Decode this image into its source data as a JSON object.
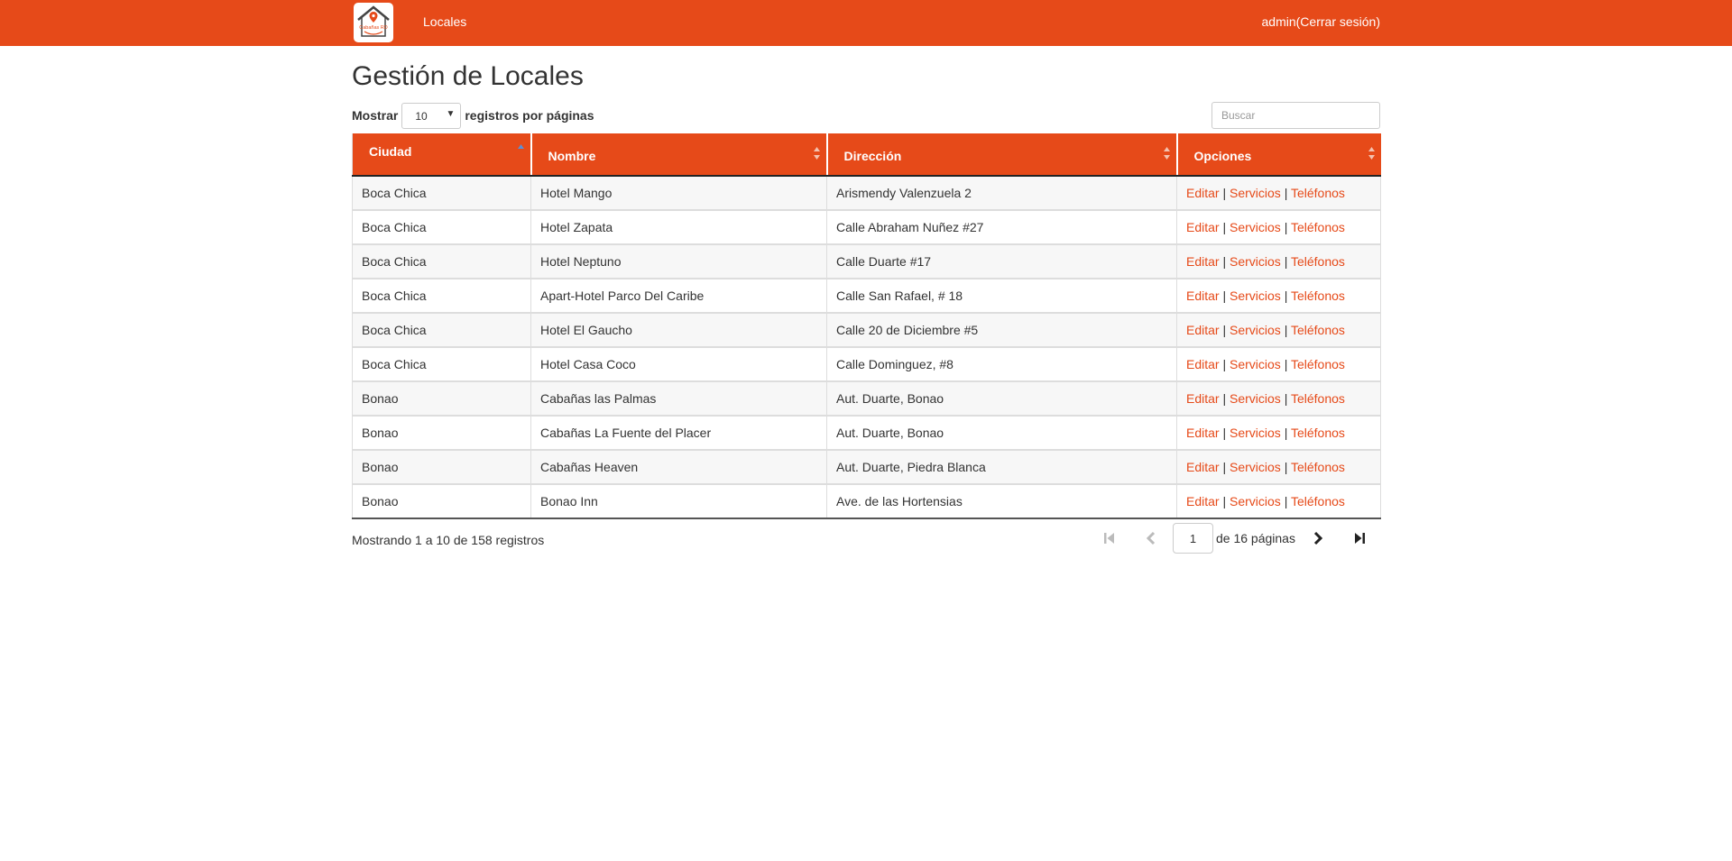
{
  "header": {
    "logo_text": "Cabañas RD",
    "nav_label": "Locales",
    "user_label": "admin(Cerrar sesión)"
  },
  "page": {
    "title": "Gestión de Locales"
  },
  "length_control": {
    "prefix": "Mostrar",
    "selected": "10",
    "suffix": "registros por páginas"
  },
  "search": {
    "placeholder": "Buscar",
    "value": ""
  },
  "table": {
    "columns": [
      "Ciudad",
      "Nombre",
      "Dirección",
      "Opciones"
    ],
    "sorted_column": "Ciudad",
    "rows": [
      {
        "ciudad": "Boca Chica",
        "nombre": "Hotel Mango",
        "direccion": "Arismendy Valenzuela 2"
      },
      {
        "ciudad": "Boca Chica",
        "nombre": "Hotel Zapata",
        "direccion": "Calle Abraham Nuñez #27"
      },
      {
        "ciudad": "Boca Chica",
        "nombre": "Hotel Neptuno",
        "direccion": "Calle Duarte #17"
      },
      {
        "ciudad": "Boca Chica",
        "nombre": "Apart-Hotel Parco Del Caribe",
        "direccion": "Calle San Rafael, # 18"
      },
      {
        "ciudad": "Boca Chica",
        "nombre": "Hotel El Gaucho",
        "direccion": "Calle 20 de Diciembre #5"
      },
      {
        "ciudad": "Boca Chica",
        "nombre": "Hotel Casa Coco",
        "direccion": "Calle Dominguez, #8"
      },
      {
        "ciudad": "Bonao",
        "nombre": "Cabañas las Palmas",
        "direccion": "Aut. Duarte, Bonao"
      },
      {
        "ciudad": "Bonao",
        "nombre": "Cabañas La Fuente del Placer",
        "direccion": "Aut. Duarte, Bonao"
      },
      {
        "ciudad": "Bonao",
        "nombre": "Cabañas Heaven",
        "direccion": "Aut. Duarte, Piedra Blanca"
      },
      {
        "ciudad": "Bonao",
        "nombre": "Bonao Inn",
        "direccion": "Ave. de las Hortensias"
      }
    ],
    "options": {
      "edit": "Editar",
      "services": "Servicios",
      "phones": "Teléfonos",
      "separator": "|"
    }
  },
  "footer": {
    "info": "Mostrando 1 a 10 de 158 registros",
    "current_page": "1",
    "pages_label": "de 16 páginas"
  },
  "icons": {
    "first": "first-page-icon",
    "prev": "prev-page-icon",
    "next": "next-page-icon",
    "last": "last-page-icon",
    "sort": "sort-icon"
  },
  "colors": {
    "brand": "#e64a19",
    "link": "#e64a19",
    "disabled_icon": "#bbbbbb"
  }
}
